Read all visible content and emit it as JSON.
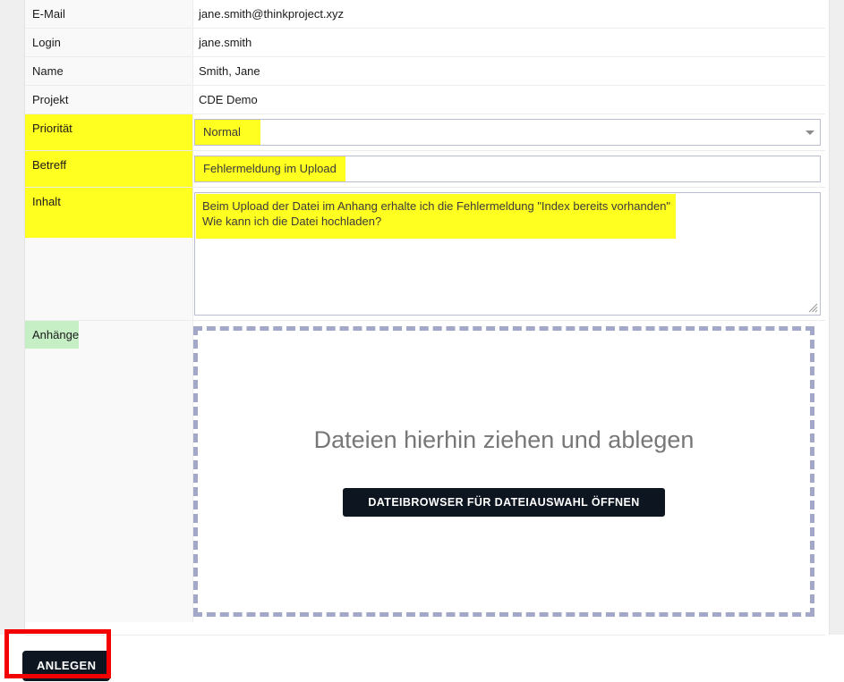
{
  "form": {
    "rows": [
      {
        "label": "E-Mail",
        "type": "static",
        "value": "jane.smith@thinkproject.xyz",
        "label_highlight": "none"
      },
      {
        "label": "Login",
        "type": "static",
        "value": "jane.smith",
        "label_highlight": "none"
      },
      {
        "label": "Name",
        "type": "static",
        "value": "Smith, Jane",
        "label_highlight": "none"
      },
      {
        "label": "Projekt",
        "type": "static",
        "value": "CDE Demo",
        "label_highlight": "none"
      },
      {
        "label": "Priorität",
        "type": "select",
        "value": "Normal",
        "label_highlight": "yellow"
      },
      {
        "label": "Betreff",
        "type": "text",
        "value": "Fehlermeldung im Upload",
        "label_highlight": "yellow"
      },
      {
        "label": "Inhalt",
        "type": "textarea",
        "value": "Beim Upload der Datei im Anhang erhalte ich die Fehlermeldung \"Index bereits vorhanden\"\nWie kann ich die Datei hochladen?",
        "label_highlight": "yellow"
      },
      {
        "label": "Anhänge",
        "type": "dropzone",
        "value": "",
        "label_highlight": "green"
      }
    ],
    "email_label": "E-Mail",
    "email_value": "jane.smith@thinkproject.xyz",
    "login_label": "Login",
    "login_value": "jane.smith",
    "name_label": "Name",
    "name_value": "Smith, Jane",
    "projekt_label": "Projekt",
    "projekt_value": "CDE Demo",
    "prioritaet_label": "Priorität",
    "prioritaet_value": "Normal",
    "betreff_label": "Betreff",
    "betreff_value": "Fehlermeldung im Upload",
    "inhalt_label": "Inhalt",
    "inhalt_value": "Beim Upload der Datei im Anhang erhalte ich die Fehlermeldung \"Index bereits vorhanden\"\nWie kann ich die Datei hochladen?",
    "anhaenge_label": "Anhänge"
  },
  "dropzone": {
    "hint": "Dateien hierhin ziehen und ablegen",
    "browse_button": "DATEIBROWSER FÜR DATEIAUSWAHL ÖFFNEN"
  },
  "footer": {
    "submit_label": "ANLEGEN"
  },
  "icons": {
    "select_arrow": "chevron-down-icon",
    "resize_grip": "resize-handle-icon"
  },
  "colors": {
    "highlight_yellow": "#ffff20",
    "highlight_green": "#c6efc6",
    "annotation_red": "#f50000",
    "button_dark": "#0d1520",
    "dropzone_border": "#a3a7c8"
  }
}
